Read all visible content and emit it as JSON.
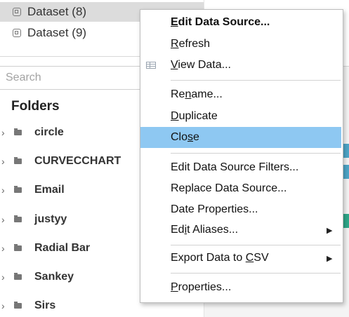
{
  "datasets": [
    {
      "label": "Dataset (8)"
    },
    {
      "label": "Dataset (9)"
    }
  ],
  "search": {
    "placeholder": "Search"
  },
  "folders": {
    "heading": "Folders",
    "items": [
      {
        "label": "circle"
      },
      {
        "label": "CURVECCHART"
      },
      {
        "label": "Email"
      },
      {
        "label": "justyy"
      },
      {
        "label": "Radial Bar"
      },
      {
        "label": "Sankey"
      },
      {
        "label": "Sirs"
      }
    ]
  },
  "context_menu": {
    "edit_data_source": {
      "pre": "",
      "key": "E",
      "post": "dit Data Source..."
    },
    "refresh": {
      "pre": "",
      "key": "R",
      "post": "efresh"
    },
    "view_data": {
      "pre": "",
      "key": "V",
      "post": "iew Data..."
    },
    "rename": {
      "pre": "Re",
      "key": "n",
      "post": "ame..."
    },
    "duplicate": {
      "pre": "",
      "key": "D",
      "post": "uplicate"
    },
    "close": {
      "pre": "Clo",
      "key": "s",
      "post": "e"
    },
    "edit_filters": {
      "label": "Edit Data Source Filters..."
    },
    "replace": {
      "label": "Replace Data Source..."
    },
    "date_properties": {
      "label": "Date Properties..."
    },
    "edit_aliases": {
      "pre": "Ed",
      "key": "i",
      "post": "t Aliases..."
    },
    "export_csv": {
      "pre": "Export Data to ",
      "key": "C",
      "post": "SV"
    },
    "properties": {
      "pre": "",
      "key": "P",
      "post": "roperties..."
    }
  },
  "colors": {
    "menu_highlight": "#8ec8f2",
    "selected_row": "#dcdcdc"
  },
  "icons": {
    "dataset": "dataset-icon",
    "folder": "folder-icon",
    "expand": "chevron-right-icon",
    "view_data": "grid-icon",
    "submenu": "submenu-arrow-icon"
  }
}
